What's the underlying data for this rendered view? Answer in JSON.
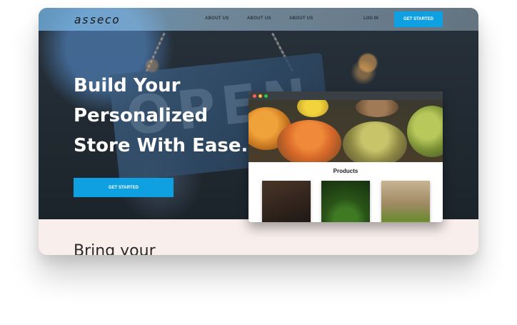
{
  "brand": {
    "logo_text": "asseco"
  },
  "nav": {
    "links": [
      "ABOUT US",
      "ABOUT US",
      "ABOUT US"
    ],
    "login_label": "LOG IN",
    "cta_label": "GET STARTED"
  },
  "hero": {
    "headline_lines": [
      "Build Your",
      "Personalized",
      "Store With Ease."
    ],
    "cta_label": "GET STARTED",
    "background_sign_text": "OPEN"
  },
  "mockup": {
    "products_title": "Products",
    "window_dots": [
      "#ff5f57",
      "#febc2e",
      "#28c840"
    ]
  },
  "bottom": {
    "heading": "Bring your"
  },
  "colors": {
    "accent": "#0ea0e0",
    "section_bg": "#f8eeec"
  }
}
